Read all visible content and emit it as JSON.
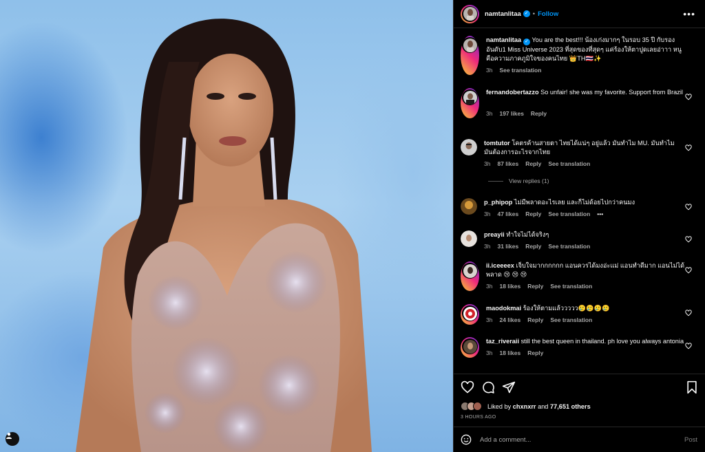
{
  "post": {
    "username": "namtanlitaa",
    "follow_label": "Follow",
    "dot": "•",
    "more_label": "•••"
  },
  "caption": {
    "username": "namtanlitaa",
    "text": "You are the best!!! น้องเก่งมากๆ ในรอบ 35 ปี กับรองอันดับ1 Miss Universe 2023 ที่สุดของที่สุดๆ แค่ร้องให้ตาปูดเลยอ่าาา หนูคือความภาคภูมิใจของคนไทย 👑TH🇹🇭✨",
    "time": "3h",
    "translate": "See translation"
  },
  "comments": [
    {
      "username": "fernandobertazzo",
      "text": "So unfair! she was my favorite. Support from Brazil",
      "time": "3h",
      "likes": "197 likes",
      "reply": "Reply",
      "translate": ""
    },
    {
      "username": "tomtutor",
      "text": "โคตรค้านสายตา ไทยได้แน่ๆ อยู่แล้ว มันทำไม MU. มันทำไม มันต้องการอะไรจากไทย",
      "time": "3h",
      "likes": "87 likes",
      "reply": "Reply",
      "translate": "See translation"
    },
    {
      "username": "p_phipop",
      "text": "ไม่มีพลาดอะไรเลย และก็ไม่ด้อยไปกว่าคนมง",
      "time": "3h",
      "likes": "47 likes",
      "reply": "Reply",
      "translate": "See translation",
      "more": "•••"
    },
    {
      "username": "preayii",
      "text": "ทำใจไม่ได้จริงๆ",
      "time": "3h",
      "likes": "31 likes",
      "reply": "Reply",
      "translate": "See translation"
    },
    {
      "username": "ii.iceeeex",
      "text": "เจ็บใจมากกกกกก แอนควรได้มงอ่ะแม่ แอนทำดีมาก แอนไม่ได้พลาด 😢 😢 😢",
      "time": "3h",
      "likes": "18 likes",
      "reply": "Reply",
      "translate": "See translation"
    },
    {
      "username": "maodokmai",
      "text": "ร้องให้ตามแล้ววววว🥲🥲🥲🥲",
      "time": "3h",
      "likes": "24 likes",
      "reply": "Reply",
      "translate": "See translation"
    },
    {
      "username": "taz_riveraii",
      "text": "still the best queen in thailand. ph love you always antonia",
      "time": "3h",
      "likes": "18 likes",
      "reply": "Reply",
      "translate": ""
    }
  ],
  "view_replies": "View replies (1)",
  "likes_section": {
    "liked_by": "Liked by",
    "liker": "chxnxrr",
    "and": "and",
    "others": "77,651 others",
    "time_ago": "3 HOURS AGO"
  },
  "composer": {
    "placeholder": "Add a comment...",
    "post_label": "Post"
  },
  "icons": [
    "person-icon",
    "verified-icon",
    "more-icon",
    "heart-icon",
    "comment-icon",
    "share-icon",
    "bookmark-icon",
    "emoji-icon"
  ],
  "colors": {
    "accent": "#0095f6",
    "background": "#000000",
    "muted": "#a8a8a8"
  }
}
